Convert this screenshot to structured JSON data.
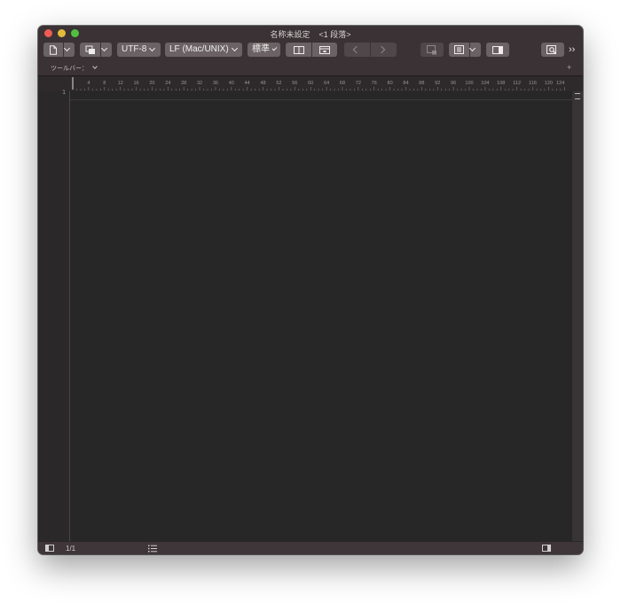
{
  "window": {
    "title": "名称未設定    <1 段落>"
  },
  "toolbar": {
    "encoding": "UTF-8",
    "line_ending": "LF (Mac/UNIX)",
    "syntax": "標準",
    "overflow": "››"
  },
  "toolbar_bar": {
    "label": "ツールバー："
  },
  "ruler": {
    "ticks": [
      "4",
      "8",
      "12",
      "16",
      "20",
      "24",
      "28",
      "32",
      "36",
      "40",
      "44",
      "48",
      "52",
      "56",
      "60",
      "64",
      "68",
      "72",
      "76",
      "80",
      "84",
      "88",
      "92",
      "96",
      "100",
      "104",
      "108",
      "112",
      "116",
      "120",
      "124"
    ]
  },
  "editor": {
    "line_numbers": [
      "1"
    ]
  },
  "status": {
    "position": "1/1"
  },
  "colors": {
    "editor_bg": "#272727",
    "chrome": "#3a3234",
    "button": "#6a6264",
    "close": "#ee5c54",
    "minimize": "#e3bb3a",
    "maximize": "#52c03f"
  },
  "icons": [
    "document-icon",
    "copy-icon",
    "single-pane-icon",
    "split-pane-icon",
    "back-arrow-icon",
    "forward-arrow-icon",
    "document-map-icon",
    "navigator-icon",
    "sidebar-icon",
    "find-icon",
    "status-toggle-icon",
    "list-icon",
    "inspector-toggle-icon"
  ]
}
